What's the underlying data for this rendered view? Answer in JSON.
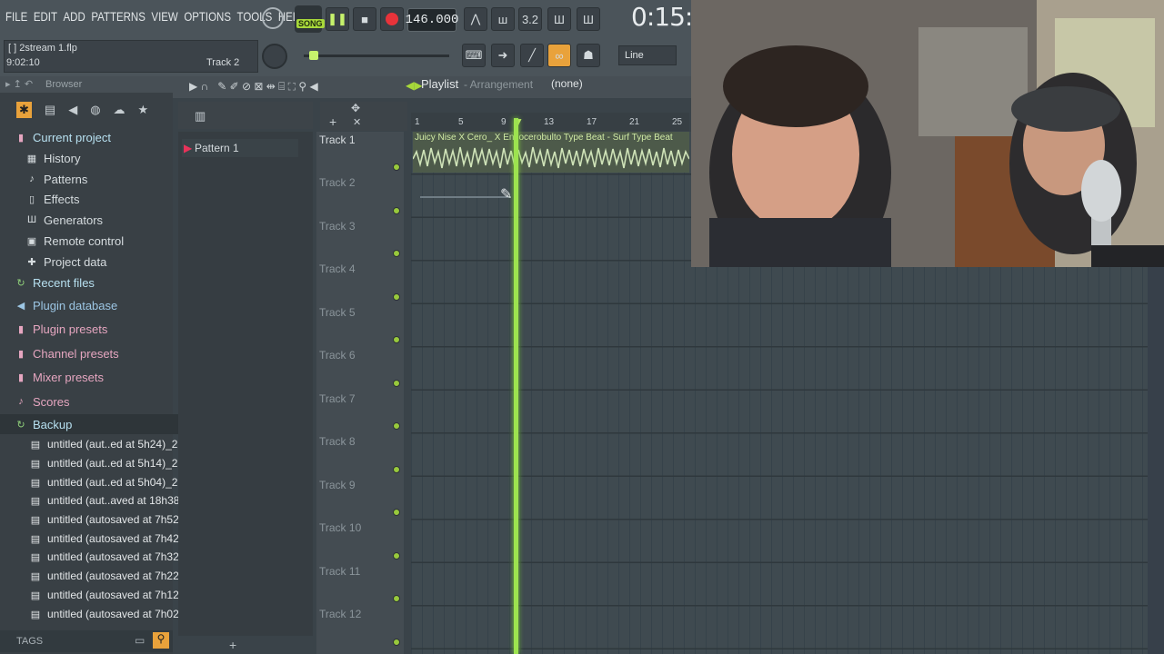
{
  "menu": [
    "FILE",
    "EDIT",
    "ADD",
    "PATTERNS",
    "VIEW",
    "OPTIONS",
    "TOOLS",
    "HELP"
  ],
  "transport": {
    "mode_label": "SONG",
    "tempo": "146.000",
    "time": "0:15:"
  },
  "hint": {
    "file": "[  ] 2stream 1.flp",
    "position": "9:02:10",
    "track": "Track 2"
  },
  "snap_mode": "Line",
  "browser": {
    "title": "Browser",
    "items": [
      {
        "label": "Current project",
        "type": "cat"
      },
      {
        "label": "History",
        "type": "sub"
      },
      {
        "label": "Patterns",
        "type": "sub"
      },
      {
        "label": "Effects",
        "type": "sub"
      },
      {
        "label": "Generators",
        "type": "sub"
      },
      {
        "label": "Remote control",
        "type": "sub"
      },
      {
        "label": "Project data",
        "type": "sub"
      },
      {
        "label": "Recent files",
        "type": "cat"
      },
      {
        "label": "Plugin database",
        "type": "cat"
      },
      {
        "label": "Plugin presets",
        "type": "cat"
      },
      {
        "label": "Channel presets",
        "type": "cat"
      },
      {
        "label": "Mixer presets",
        "type": "cat"
      },
      {
        "label": "Scores",
        "type": "cat"
      },
      {
        "label": "Backup",
        "type": "cat"
      }
    ],
    "files": [
      "untitled (aut..ed at 5h24)_2",
      "untitled (aut..ed at 5h14)_2",
      "untitled (aut..ed at 5h04)_2",
      "untitled (aut..aved at 18h38)",
      "untitled (autosaved at 7h52)",
      "untitled (autosaved at 7h42)",
      "untitled (autosaved at 7h32)",
      "untitled (autosaved at 7h22)",
      "untitled (autosaved at 7h12)",
      "untitled (autosaved at 7h02)"
    ],
    "tags_label": "TAGS"
  },
  "pattern": {
    "name": "Pattern 1"
  },
  "playlist": {
    "title": "Playlist",
    "subtitle": "- Arrangement",
    "pattern_select": "(none)",
    "ruler": [
      "1",
      "5",
      "9",
      "13",
      "17",
      "21",
      "25"
    ],
    "clip_title": "Juicy Nise X Cero_ X Enzocerobulto Type Beat - Surf Type Beat",
    "tracks": [
      "Track 1",
      "Track 2",
      "Track 3",
      "Track 4",
      "Track 5",
      "Track 6",
      "Track 7",
      "Track 8",
      "Track 9",
      "Track 10",
      "Track 11",
      "Track 12"
    ]
  },
  "colors": {
    "accent": "#9de34f",
    "record": "#e8333a",
    "mode": "#a7d83a"
  }
}
